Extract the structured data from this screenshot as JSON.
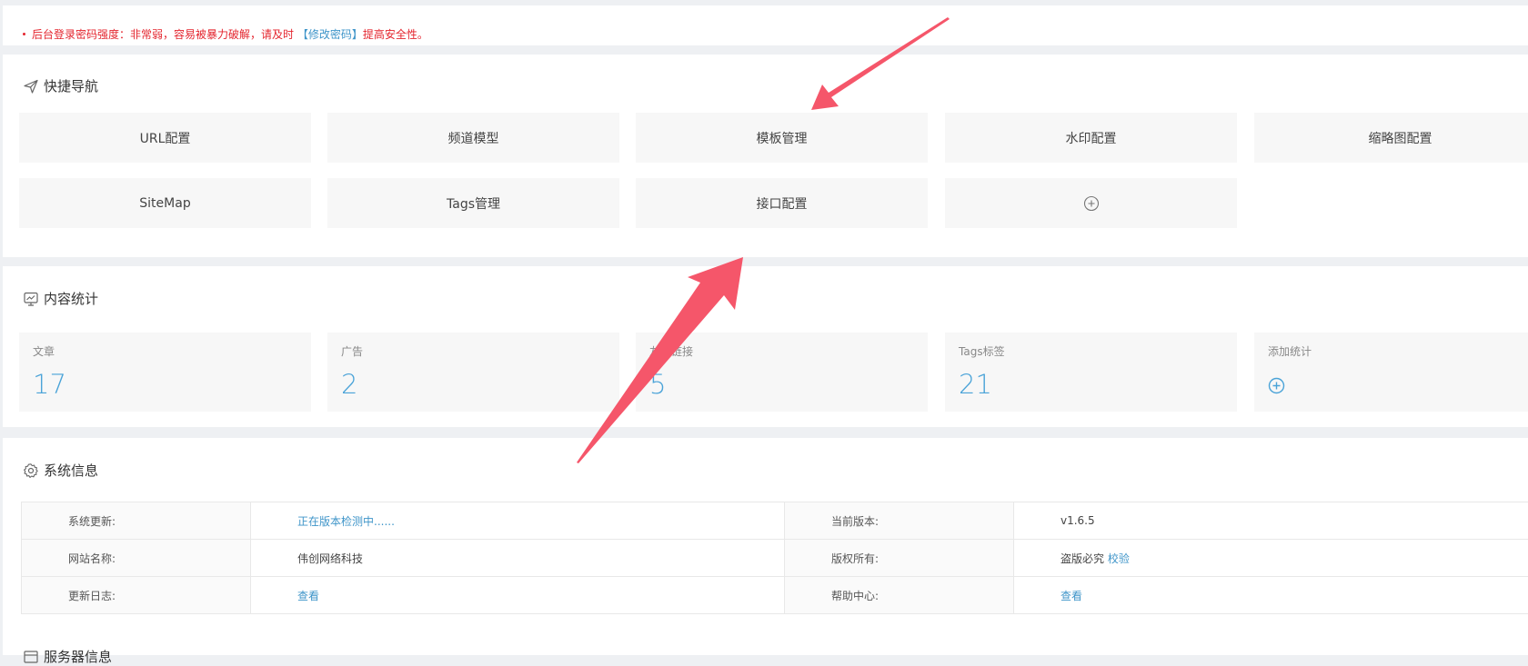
{
  "alert": {
    "prefix": "后台登录密码强度：非常弱，容易被暴力破解，请及时",
    "link": "【修改密码】",
    "suffix": "提高安全性。"
  },
  "quick_nav": {
    "title": "快捷导航",
    "tiles": [
      "URL配置",
      "频道模型",
      "模板管理",
      "水印配置",
      "缩略图配置",
      "SiteMap",
      "Tags管理",
      "接口配置"
    ]
  },
  "stats": {
    "title": "内容统计",
    "items": [
      {
        "label": "文章",
        "value": "17"
      },
      {
        "label": "广告",
        "value": "2"
      },
      {
        "label": "友情链接",
        "value": "5"
      },
      {
        "label": "Tags标签",
        "value": "21"
      }
    ],
    "add_label": "添加统计"
  },
  "system": {
    "title": "系统信息",
    "rows": [
      {
        "k1": "系统更新:",
        "v1": "正在版本检测中......",
        "k2": "当前版本:",
        "v2": "v1.6.5"
      },
      {
        "k1": "网站名称:",
        "v1": "伟创网络科技",
        "k2": "版权所有:",
        "v2": "盗版必究",
        "v2_link": "校验"
      },
      {
        "k1": "更新日志:",
        "v1": "查看",
        "k2": "帮助中心:",
        "v2": "查看"
      }
    ]
  },
  "server": {
    "title": "服务器信息"
  },
  "colors": {
    "accent": "#4aa3d8",
    "link": "#3f95c9",
    "alert": "#e4252e",
    "arrow": "#f5566a"
  }
}
